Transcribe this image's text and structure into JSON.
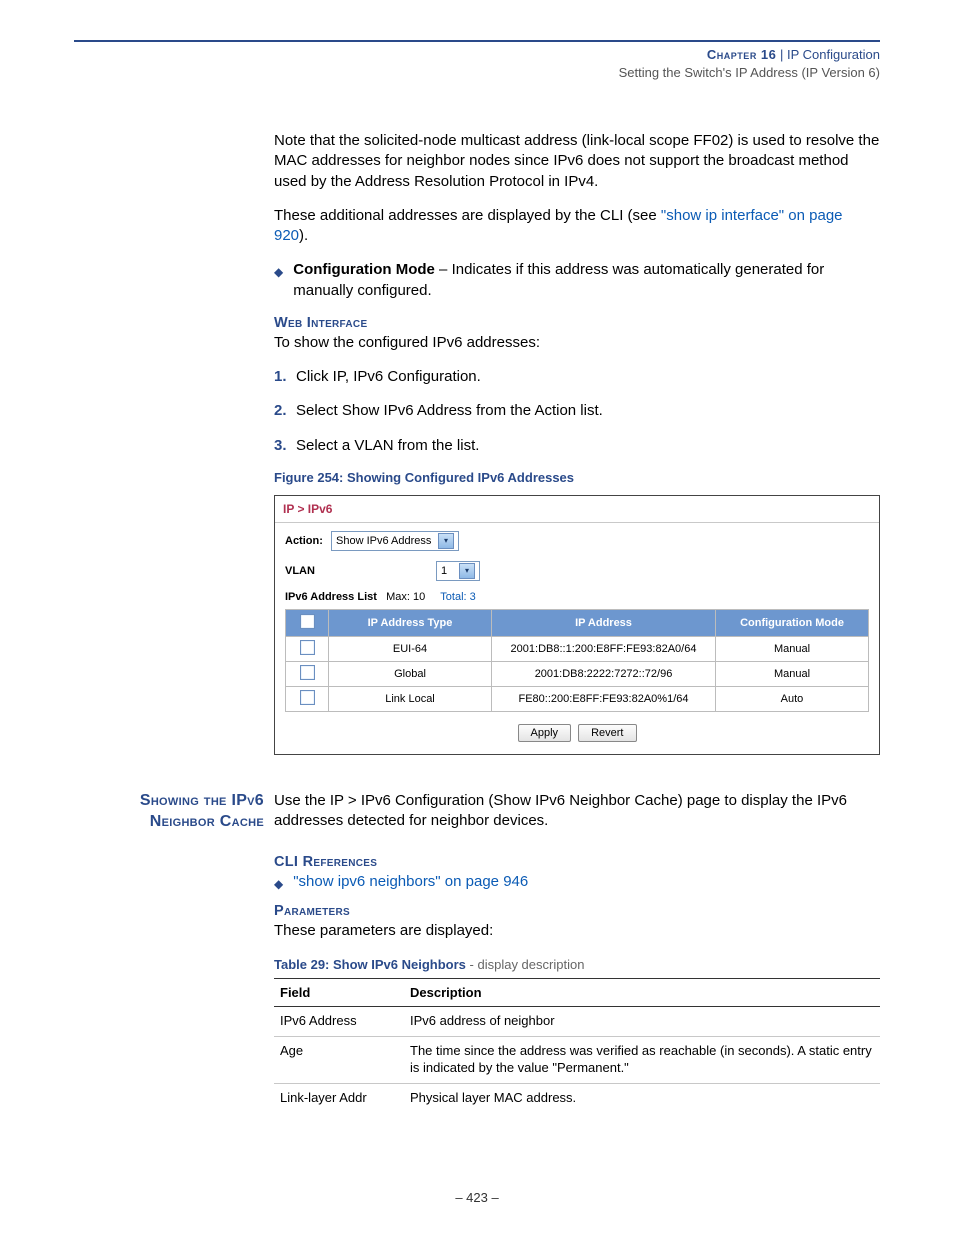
{
  "header": {
    "chapter_label": "Chapter 16",
    "pipe": "  |  ",
    "chapter_title": "IP Configuration",
    "subtitle": "Setting the Switch's IP Address (IP Version 6)"
  },
  "intro": {
    "p1": "Note that the solicited-node multicast address (link-local scope FF02) is used to resolve the MAC addresses for neighbor nodes since IPv6 does not support the broadcast method used by the Address Resolution Protocol in IPv4.",
    "p2a": "These additional addresses are displayed by the CLI (see ",
    "p2_link": "\"show ip interface\" on page 920",
    "p2b": ").",
    "bullet_symbol": "◆",
    "bullet_bold": "Configuration Mode",
    "bullet_rest": " – Indicates if this address was automatically generated for manually configured."
  },
  "web": {
    "heading": "Web Interface",
    "lead": "To show the configured IPv6 addresses:",
    "steps": [
      "Click IP, IPv6 Configuration.",
      "Select Show IPv6 Address from the Action list.",
      "Select a VLAN from the list."
    ]
  },
  "figure": {
    "caption": "Figure 254:  Showing Configured IPv6 Addresses",
    "breadcrumb": "IP > IPv6",
    "action_label": "Action:",
    "action_value": "Show IPv6 Address",
    "vlan_label": "VLAN",
    "vlan_value": "1",
    "list_label": "IPv6 Address List",
    "max_label": "Max: 10",
    "total_label": "Total: 3",
    "headers": [
      "IP Address Type",
      "IP Address",
      "Configuration Mode"
    ],
    "rows": [
      {
        "type": "EUI-64",
        "addr": "2001:DB8::1:200:E8FF:FE93:82A0/64",
        "mode": "Manual"
      },
      {
        "type": "Global",
        "addr": "2001:DB8:2222:7272::72/96",
        "mode": "Manual"
      },
      {
        "type": "Link Local",
        "addr": "FE80::200:E8FF:FE93:82A0%1/64",
        "mode": "Auto"
      }
    ],
    "apply": "Apply",
    "revert": "Revert"
  },
  "section2": {
    "side_heading_l1": "Showing the IPv6",
    "side_heading_l2": "Neighbor Cache",
    "body": "Use the IP > IPv6 Configuration (Show IPv6 Neighbor Cache) page to display the IPv6 addresses detected for neighbor devices.",
    "cli_heading": "CLI References",
    "cli_link": "\"show ipv6 neighbors\" on page 946",
    "params_heading": "Parameters",
    "params_lead": "These parameters are displayed:",
    "table_caption_strong": "Table 29: Show IPv6 Neighbors",
    "table_caption_rest": " - display description",
    "table_headers": [
      "Field",
      "Description"
    ],
    "table_rows": [
      {
        "f": "IPv6 Address",
        "d": "IPv6 address of neighbor"
      },
      {
        "f": "Age",
        "d": "The time since the address was verified as reachable (in seconds). A static entry is indicated by the value \"Permanent.\""
      },
      {
        "f": "Link-layer Addr",
        "d": "Physical layer MAC address."
      }
    ]
  },
  "footer": {
    "page": "–  423  –"
  }
}
